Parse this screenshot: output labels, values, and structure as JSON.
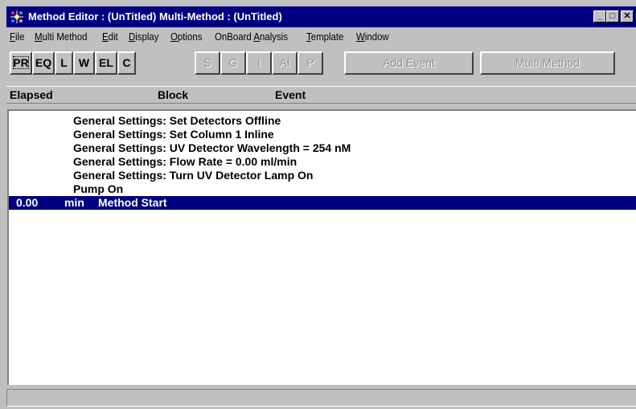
{
  "window": {
    "title": "Method Editor : (UnTitled)   Multi-Method : (UnTitled)",
    "minimize_glyph": "_",
    "restore_glyph": "□",
    "close_glyph": "✕"
  },
  "menu": [
    {
      "label": "File",
      "u": "F",
      "rest": "ile"
    },
    {
      "label": "Multi Method",
      "u": "M",
      "rest": "ulti Method"
    },
    {
      "label": "Edit",
      "u": "E",
      "rest": "dit"
    },
    {
      "label": "Display",
      "u": "D",
      "rest": "isplay"
    },
    {
      "label": "Options",
      "u": "O",
      "rest": "ptions"
    },
    {
      "label": "OnBoard Analysis",
      "pre": "OnBoard ",
      "u": "A",
      "rest": "nalysis"
    },
    {
      "label": "Template",
      "u": "T",
      "rest": "emplate"
    },
    {
      "label": "Window",
      "u": "W",
      "rest": "indow"
    }
  ],
  "toolbar": {
    "mode_buttons": [
      "PR",
      "EQ",
      "L",
      "W",
      "EL",
      "C"
    ],
    "disabled_buttons": [
      "S",
      "G",
      "I",
      "AI",
      "P"
    ],
    "add_event": "Add Event",
    "multi_method": "Multi Method"
  },
  "header": {
    "elapsed": "Elapsed",
    "block": "Block",
    "event": "Event"
  },
  "events": [
    {
      "elapsed": "",
      "unit": "",
      "text": "General Settings: Set Detectors Offline",
      "selected": false
    },
    {
      "elapsed": "",
      "unit": "",
      "text": "General Settings: Set Column 1 Inline",
      "selected": false
    },
    {
      "elapsed": "",
      "unit": "",
      "text": "General Settings: UV Detector Wavelength = 254 nM",
      "selected": false
    },
    {
      "elapsed": "",
      "unit": "",
      "text": "General Settings: Flow Rate = 0.00 ml/min",
      "selected": false
    },
    {
      "elapsed": "",
      "unit": "",
      "text": "General Settings: Turn UV Detector Lamp On",
      "selected": false
    },
    {
      "elapsed": "",
      "unit": "",
      "text": "Pump On",
      "selected": false
    },
    {
      "elapsed": "0.00",
      "unit": "min",
      "text": "Method Start",
      "selected": true
    }
  ],
  "status": {
    "text": ""
  },
  "colors": {
    "titlebar": "#000080",
    "face": "#c0c0c0",
    "selection": "#000080"
  }
}
